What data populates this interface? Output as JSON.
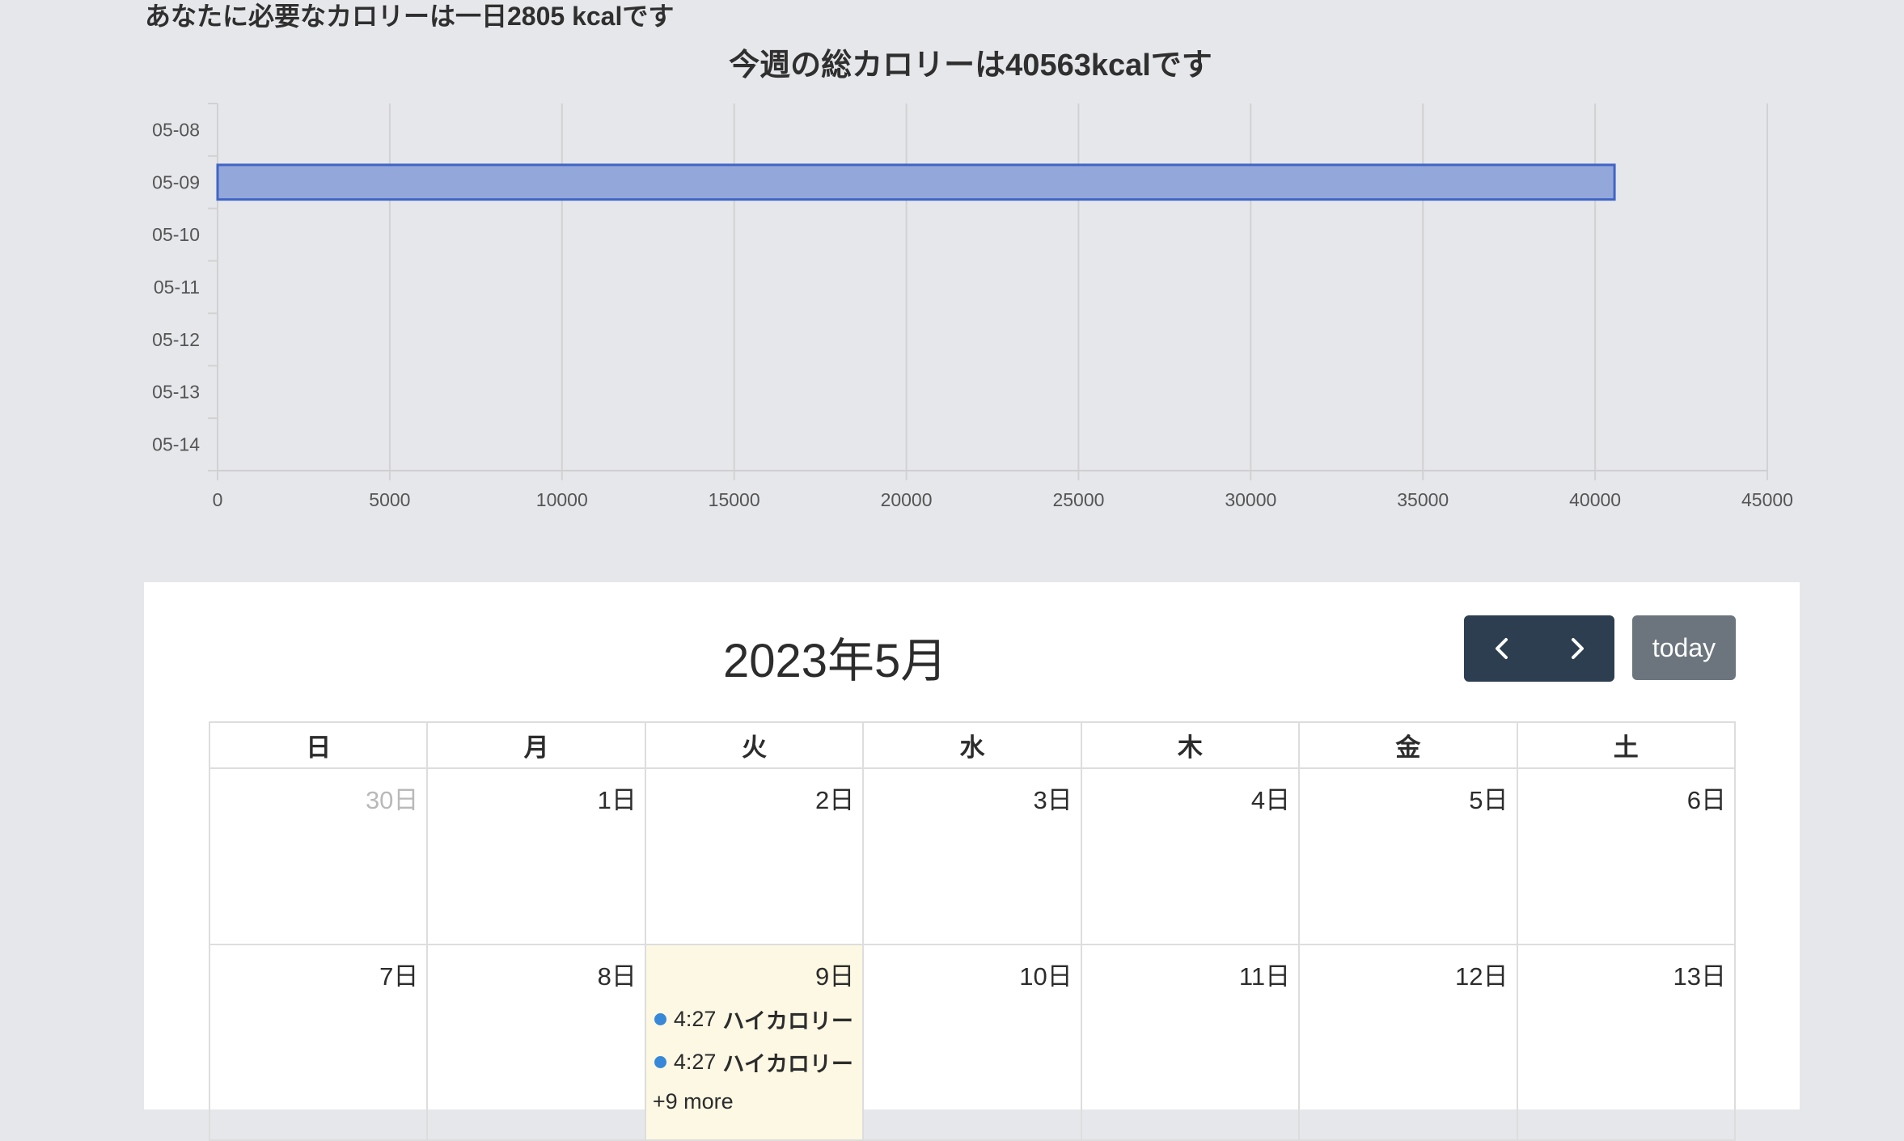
{
  "header": {
    "daily_need_text": "あなたに必要なカロリーは一日2805 kcalです"
  },
  "chart_data": {
    "type": "bar",
    "orientation": "horizontal",
    "title": "今週の総カロリーは40563kcalです",
    "categories": [
      "05-08",
      "05-09",
      "05-10",
      "05-11",
      "05-12",
      "05-13",
      "05-14"
    ],
    "values": [
      0,
      40563,
      0,
      0,
      0,
      0,
      0
    ],
    "xlim": [
      0,
      45000
    ],
    "xticks": [
      "0",
      "5000",
      "10000",
      "15000",
      "20000",
      "25000",
      "30000",
      "35000",
      "40000",
      "45000"
    ],
    "xlabel": "",
    "ylabel": "",
    "grid": true,
    "bar_color": "#94a7da",
    "bar_border_color": "#3f65c6"
  },
  "calendar": {
    "title": "2023年5月",
    "today_label": "today",
    "prev_icon": "chevron-left-icon",
    "next_icon": "chevron-right-icon",
    "weekdays": [
      "日",
      "月",
      "火",
      "水",
      "木",
      "金",
      "土"
    ],
    "week1": [
      {
        "day": "30日",
        "other_month": true
      },
      {
        "day": "1日"
      },
      {
        "day": "2日"
      },
      {
        "day": "3日"
      },
      {
        "day": "4日"
      },
      {
        "day": "5日"
      },
      {
        "day": "6日"
      }
    ],
    "week2": [
      {
        "day": "7日"
      },
      {
        "day": "8日"
      },
      {
        "day": "9日",
        "today": true
      },
      {
        "day": "10日"
      },
      {
        "day": "11日"
      },
      {
        "day": "12日"
      },
      {
        "day": "13日"
      }
    ],
    "events": [
      {
        "time": "4:27",
        "title": "ハイカロリー"
      },
      {
        "time": "4:27",
        "title": "ハイカロリー"
      }
    ],
    "more_label": "+9 more",
    "colors": {
      "nav_bg": "#2c3e50",
      "today_btn_bg": "#6c757d",
      "today_cell_bg": "#fcf8e3",
      "event_dot": "#3788d8"
    }
  }
}
